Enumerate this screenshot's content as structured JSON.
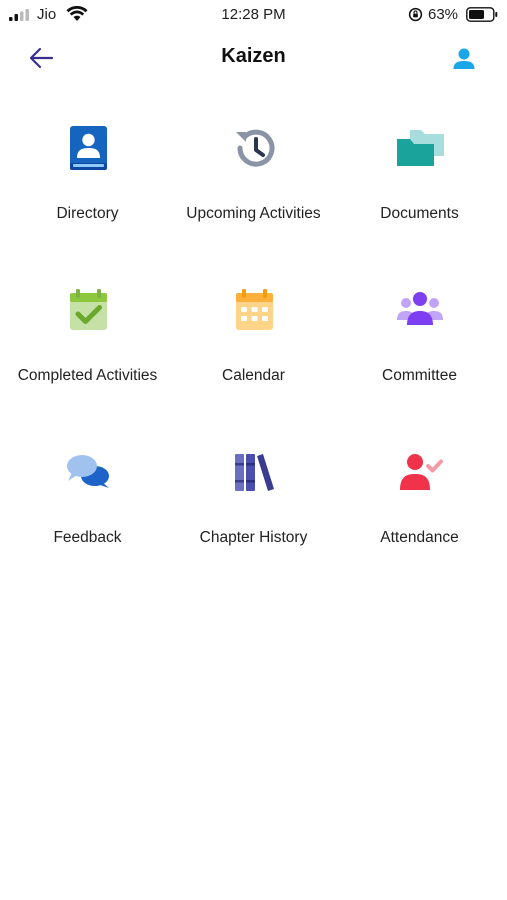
{
  "status_bar": {
    "carrier": "Jio",
    "time": "12:28 PM",
    "battery": "63%"
  },
  "header": {
    "title": "Kaizen",
    "back_icon": "arrow-left-icon",
    "profile_icon": "person-icon"
  },
  "menu": [
    {
      "label": "Directory",
      "icon": "contact-book-icon",
      "color": "#1565c0"
    },
    {
      "label": "Upcoming Activities",
      "icon": "history-clock-icon",
      "color": "#8a94a6"
    },
    {
      "label": "Documents",
      "icon": "folders-icon",
      "color": "#1aa39a"
    },
    {
      "label": "Completed Activities",
      "icon": "calendar-check-icon",
      "color": "#8dc63f"
    },
    {
      "label": "Calendar",
      "icon": "calendar-icon",
      "color": "#fbb03b"
    },
    {
      "label": "Committee",
      "icon": "group-icon",
      "color": "#7e3ff2"
    },
    {
      "label": "Feedback",
      "icon": "chat-bubbles-icon",
      "color": "#1e63c7"
    },
    {
      "label": "Chapter History",
      "icon": "books-icon",
      "color": "#3a3d8f"
    },
    {
      "label": "Attendance",
      "icon": "person-check-icon",
      "color": "#f0334a"
    }
  ]
}
